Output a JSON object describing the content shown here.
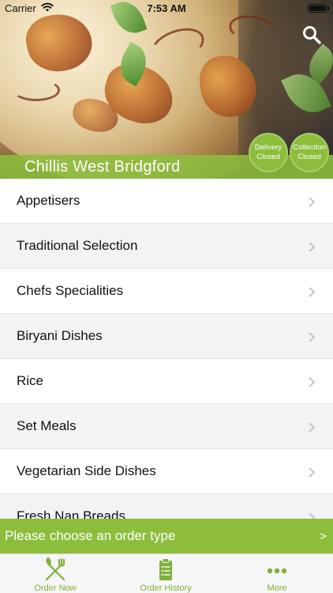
{
  "status_bar": {
    "carrier": "Carrier",
    "time": "7:53 AM"
  },
  "header": {
    "restaurant_name": "Chillis West Bridgford",
    "search_icon": "search-icon"
  },
  "service_status": {
    "delivery": {
      "title": "Delivery",
      "state": "Closed"
    },
    "collection": {
      "title": "Collection",
      "state": "Closed"
    }
  },
  "menu": {
    "categories": [
      {
        "label": "Appetisers"
      },
      {
        "label": "Traditional Selection"
      },
      {
        "label": "Chefs Specialities"
      },
      {
        "label": "Biryani Dishes"
      },
      {
        "label": "Rice"
      },
      {
        "label": "Set Meals"
      },
      {
        "label": "Vegetarian Side Dishes"
      },
      {
        "label": "Fresh Nan Breads"
      }
    ]
  },
  "order_type_bar": {
    "text": "Please choose an order type",
    "arrow": ">"
  },
  "tab_bar": {
    "tabs": [
      {
        "label": "Order Now",
        "icon": "fork-knife-icon"
      },
      {
        "label": "Order History",
        "icon": "clipboard-icon"
      },
      {
        "label": "More",
        "icon": "more-dots-icon"
      }
    ]
  },
  "colors": {
    "accent_green": "#8cbe3c",
    "tab_label_green": "#7fb13a",
    "list_alt_row": "#f3f3f4"
  }
}
